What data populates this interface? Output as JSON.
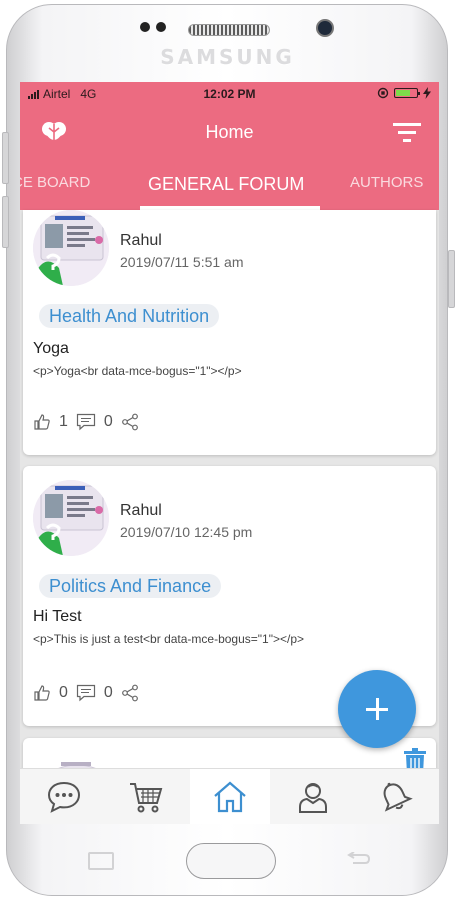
{
  "device": {
    "brand": "SAMSUNG"
  },
  "status_bar": {
    "carrier": "Airtel",
    "network": "4G",
    "time": "12:02 PM",
    "battery_level": 0.7
  },
  "app_bar": {
    "title": "Home"
  },
  "tabs": [
    {
      "label": "CE BOARD",
      "active": false
    },
    {
      "label": "GENERAL FORUM",
      "active": true
    },
    {
      "label": "AUTHORS",
      "active": false
    }
  ],
  "posts": [
    {
      "author": "Rahul",
      "date": "2019/07/11 5:51 am",
      "category": "Health And Nutrition",
      "title": "Yoga",
      "body": "<p>Yoga<br data-mce-bogus=\"1\"></p>",
      "likes": "1",
      "comments": "0"
    },
    {
      "author": "Rahul",
      "date": "2019/07/10 12:45 pm",
      "category": "Politics And Finance",
      "title": "Hi Test",
      "body": "<p>This is just a test<br data-mce-bogus=\"1\"></p>",
      "likes": "0",
      "comments": "0"
    }
  ],
  "bottom_nav": [
    {
      "icon": "chat-icon",
      "active": false
    },
    {
      "icon": "cart-icon",
      "active": false
    },
    {
      "icon": "home-icon",
      "active": true
    },
    {
      "icon": "profile-icon",
      "active": false
    },
    {
      "icon": "bell-icon",
      "active": false
    }
  ],
  "colors": {
    "accent": "#ec6b81",
    "link": "#3d8fd0",
    "fab": "#3f97dd"
  }
}
